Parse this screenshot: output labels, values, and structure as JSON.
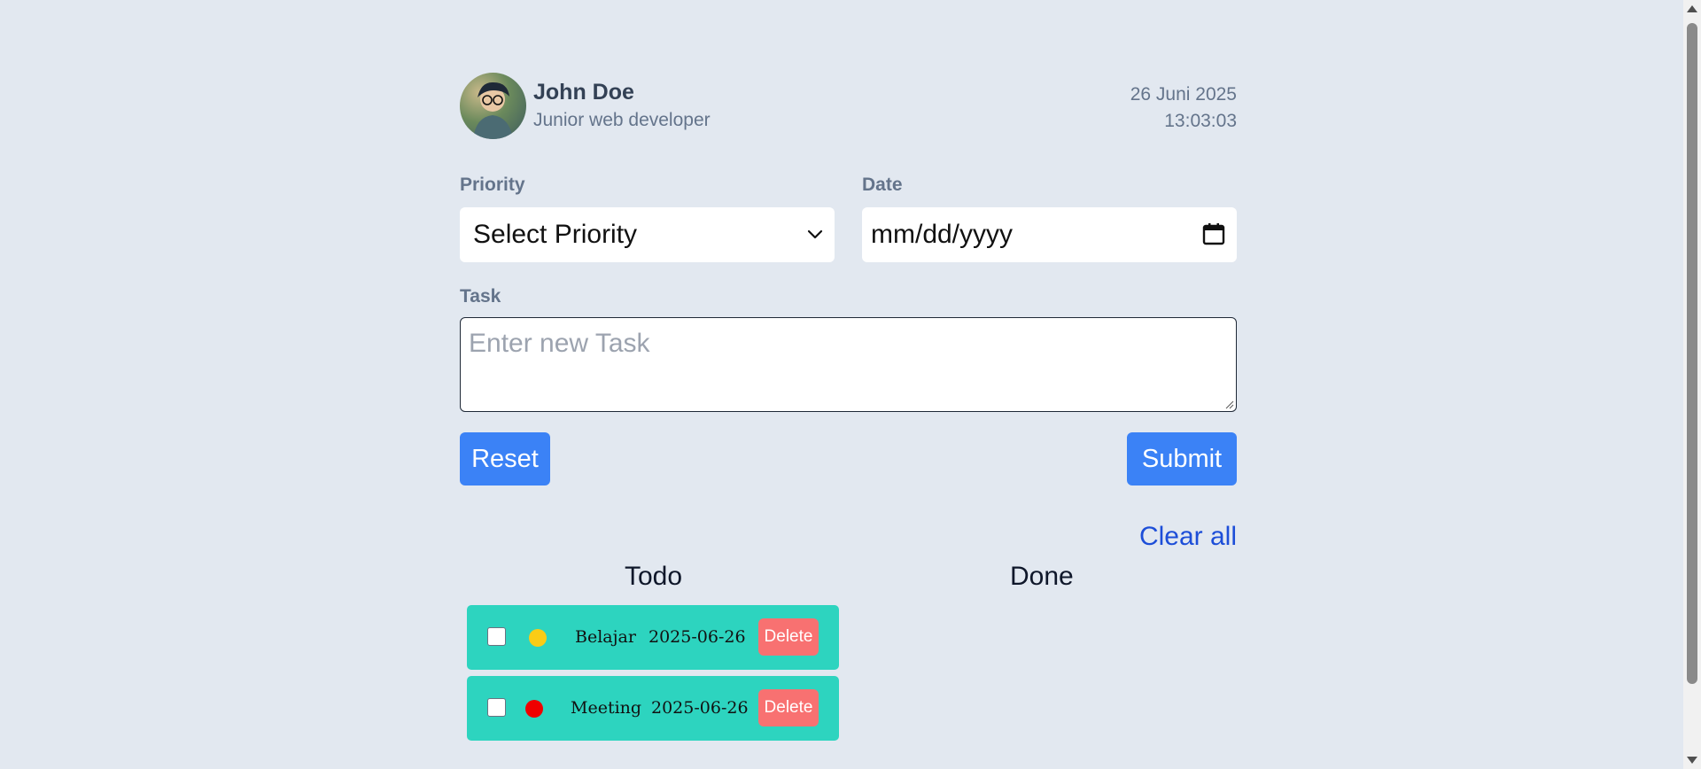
{
  "profile": {
    "name": "John Doe",
    "role": "Junior web developer",
    "date": "26 Juni 2025",
    "time": "13:03:03",
    "avatar_icon": "person-avatar"
  },
  "form": {
    "priority_label": "Priority",
    "priority_value": "Select Priority",
    "date_label": "Date",
    "date_placeholder": "mm/dd/yyyy",
    "task_label": "Task",
    "task_placeholder": "Enter new Task",
    "reset_label": "Reset",
    "submit_label": "Submit"
  },
  "lists": {
    "clear_all_label": "Clear all",
    "todo_title": "Todo",
    "done_title": "Done",
    "todo_items": [
      {
        "name": "Belajar",
        "date": "2025-06-26",
        "priority_color": "#facc15",
        "delete_label": "Delete"
      },
      {
        "name": "Meeting",
        "date": "2025-06-26",
        "priority_color": "#ef0000",
        "delete_label": "Delete"
      }
    ]
  },
  "colors": {
    "background": "#e2e8f0",
    "accent": "#3b82f6",
    "card": "#2dd4bf",
    "danger": "#f87171",
    "link": "#1d4ed8"
  }
}
